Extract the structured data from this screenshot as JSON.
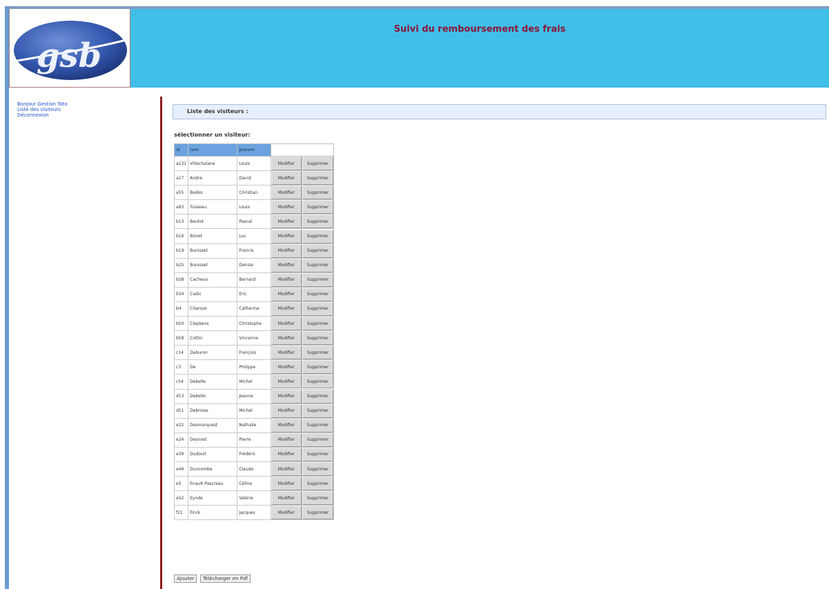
{
  "header": {
    "logo_text": "gsb",
    "title": "Suivi du remboursement des frais"
  },
  "sidebar": {
    "items": [
      "Bonjour Gestion Toto",
      "Liste des visiteurs",
      "Déconnexion"
    ]
  },
  "section": {
    "title": "Liste des visiteurs :"
  },
  "select_label": "sélectionner un visiteur:",
  "table": {
    "columns": [
      "id",
      "nom",
      "prenom",
      ""
    ],
    "modify_label": "Modifier",
    "delete_label": "Supprimer",
    "rows": [
      [
        "a131",
        "Villechalane",
        "Louis"
      ],
      [
        "a17",
        "Andre",
        "David"
      ],
      [
        "a55",
        "Bedos",
        "Christian"
      ],
      [
        "a93",
        "Tusseau",
        "Louis"
      ],
      [
        "b13",
        "Bentot",
        "Pascal"
      ],
      [
        "b16",
        "Bioret",
        "Luc"
      ],
      [
        "b19",
        "Bunisset",
        "Francis"
      ],
      [
        "b25",
        "Bunisset",
        "Denise"
      ],
      [
        "b28",
        "Cacheux",
        "Bernard"
      ],
      [
        "b34",
        "Cadic",
        "Eric"
      ],
      [
        "b4",
        "Charoze",
        "Catherine"
      ],
      [
        "b50",
        "Clepkens",
        "Christophe"
      ],
      [
        "b59",
        "Cottin",
        "Vincenne"
      ],
      [
        "c14",
        "Daburon",
        "François"
      ],
      [
        "c3",
        "De",
        "Philippe"
      ],
      [
        "c54",
        "Debelle",
        "Michel"
      ],
      [
        "d13",
        "Debelle",
        "Jeanne"
      ],
      [
        "d51",
        "Debroise",
        "Michel"
      ],
      [
        "e22",
        "Desmarquest",
        "Nathalie"
      ],
      [
        "e24",
        "Desnost",
        "Pierre"
      ],
      [
        "e39",
        "Dudouit",
        "Frédéric"
      ],
      [
        "e49",
        "Duncombe",
        "Claude"
      ],
      [
        "e5",
        "Enault-Pascreau",
        "Céline"
      ],
      [
        "e52",
        "Eynde",
        "Valérie"
      ],
      [
        "f21",
        "Finck",
        "Jacques"
      ]
    ]
  },
  "buttons": {
    "add": "Ajouter",
    "pdf": "Télécharger en Pdf"
  },
  "colors": {
    "header": "#40bfe8",
    "title": "#8a1538",
    "divider": "#8a1c1c",
    "table_header": "#6aa3df"
  }
}
